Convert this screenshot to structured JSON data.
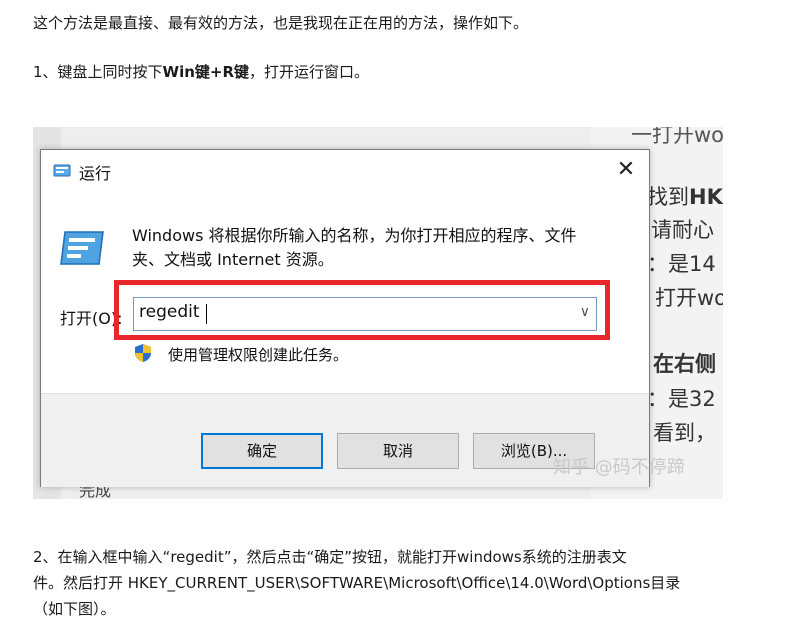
{
  "paragraphs": {
    "intro": "这个方法是最直接、最有效的方法，也是我现在正在用的方法，操作如下。",
    "step1_prefix": "1、键盘上同时按下",
    "step1_keys": "Win键+R键",
    "step1_suffix": "，打开运行窗口。",
    "step2_line1": "2、在输入框中输入“regedit”，然后点击“确定”按钮，就能打开windows系统的注册表文",
    "step2_line2": "件。然后打开 HKEY_CURRENT_USER\\SOFTWARE\\Microsoft\\Office\\14.0\\Word\\Options目录",
    "step2_line3": "（如下图）。"
  },
  "screenshot_background": {
    "frag1": "一打开wo",
    "frag2_prefix": "找到",
    "frag2_bold": "HK",
    "frag3": "请耐心",
    "frag4": "：是14",
    "frag5": "打开wo",
    "frag6": "在右侧",
    "frag7": "：是32",
    "frag8": "看到，",
    "bottom_left": "完成",
    "watermark": "知乎 @码不停蹄"
  },
  "run_dialog": {
    "title": "运行",
    "description": "Windows 将根据你所输入的名称，为你打开相应的程序、文件夹、文档或 Internet 资源。",
    "open_label": "打开(O):",
    "input_value": "regedit",
    "admin_note": "使用管理权限创建此任务。",
    "ok_label": "确定",
    "cancel_label": "取消",
    "browse_label": "浏览(B)...",
    "highlight_color": "#e8262c",
    "accent_color": "#0078d7"
  }
}
